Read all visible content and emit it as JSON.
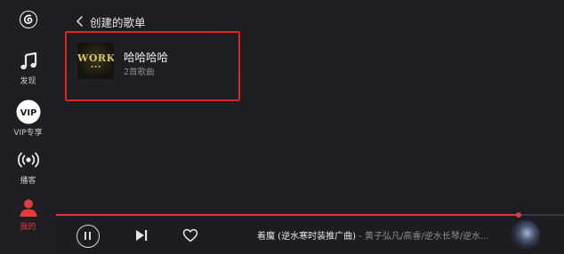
{
  "sidebar": {
    "items": [
      {
        "label": "发现",
        "icon": "music-note-icon"
      },
      {
        "label": "VIP专享",
        "icon": "vip-icon",
        "badge": "VIP"
      },
      {
        "label": "播客",
        "icon": "podcast-icon"
      },
      {
        "label": "我的",
        "icon": "user-icon",
        "active": true
      }
    ]
  },
  "header": {
    "title": "创建的歌单"
  },
  "playlists": [
    {
      "name": "哈哈哈哈",
      "count": "2首歌曲",
      "cover_text": "WORK"
    }
  ],
  "player": {
    "song_title": "着魔 (逆水寒时装推广曲)",
    "song_artist": " - 黄子弘凡/高睿/逆水长琴/逆水...",
    "progress": 0.91
  },
  "colors": {
    "accent": "#e33b3b",
    "highlight_border": "#e02424",
    "background": "#1e1d24"
  }
}
